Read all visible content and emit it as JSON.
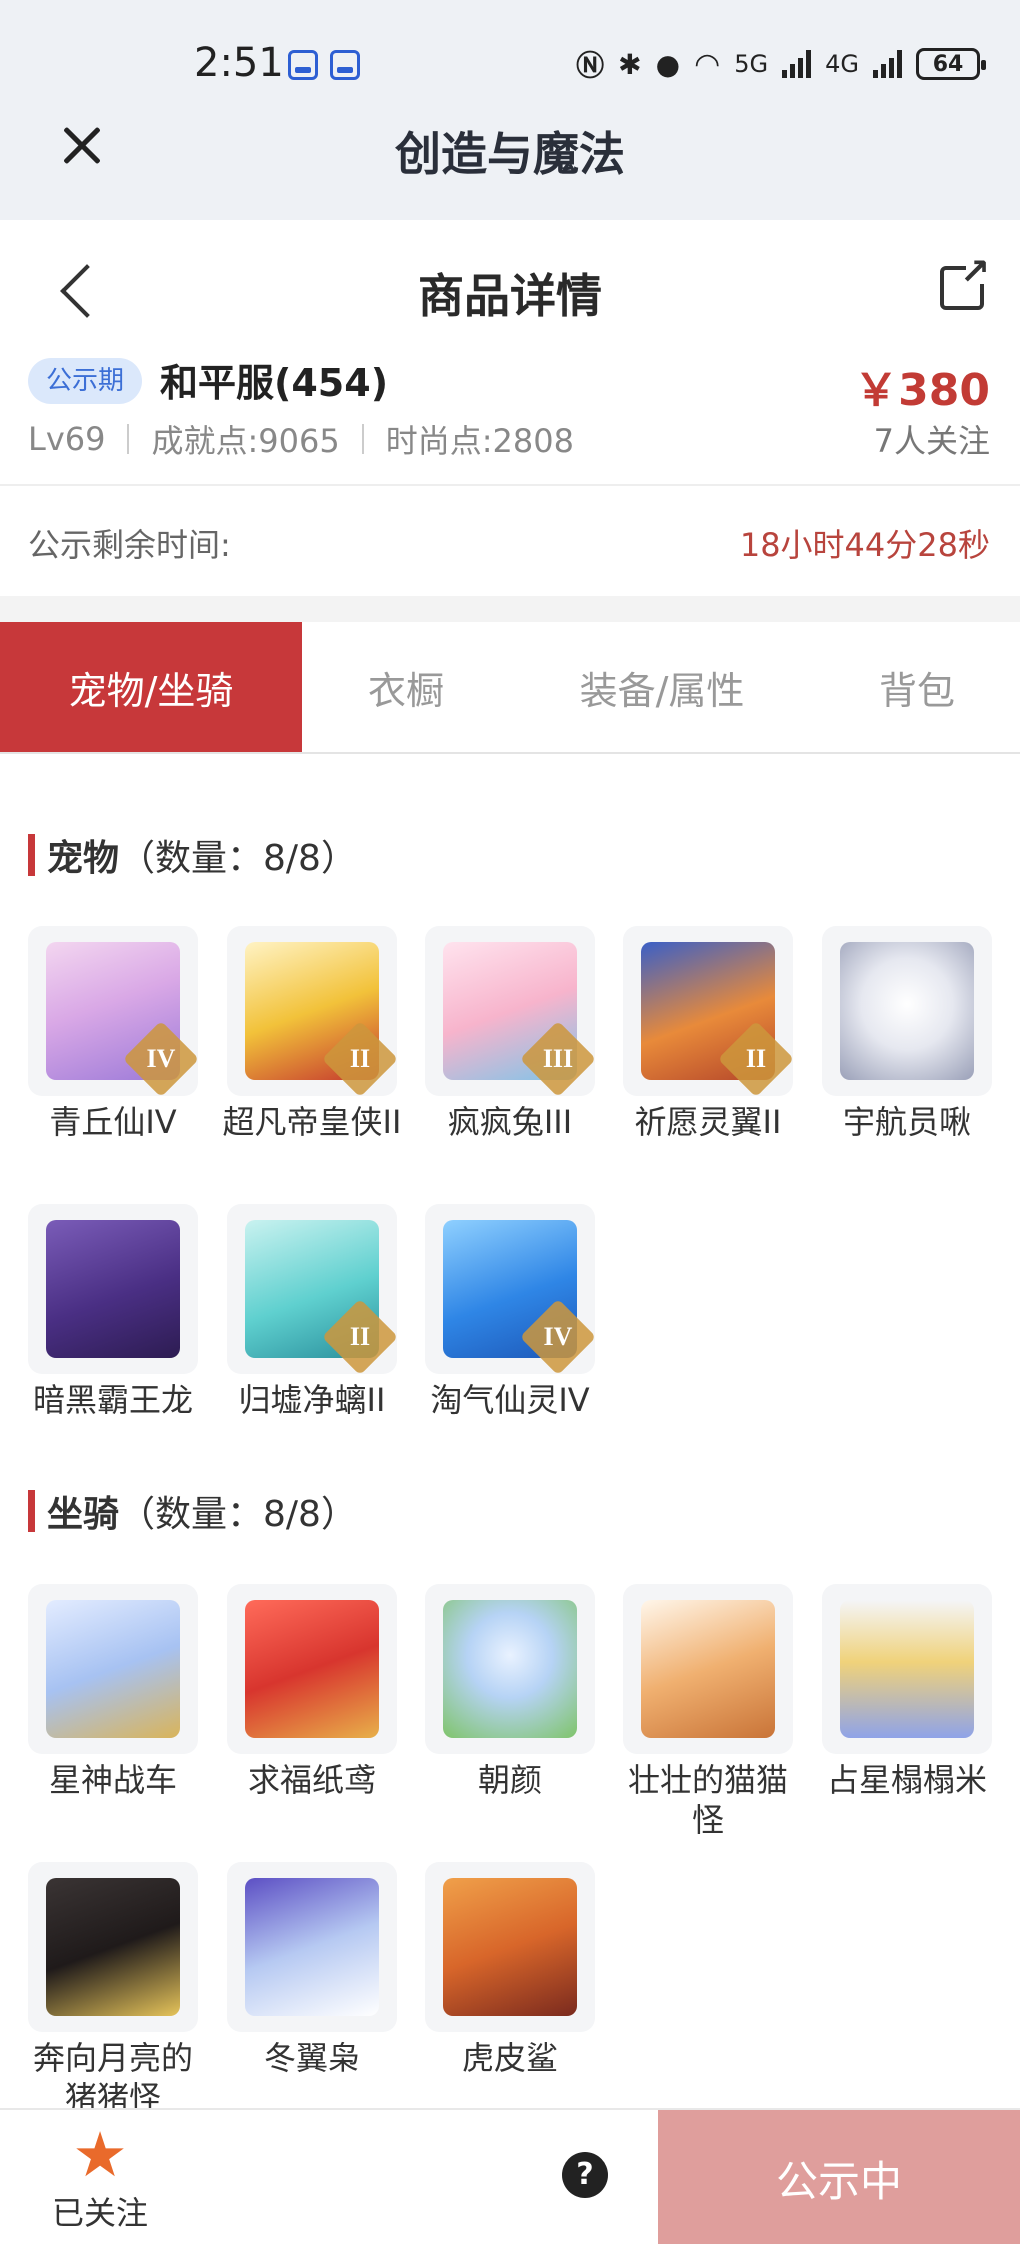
{
  "status_bar": {
    "time": "2:51",
    "battery": "64",
    "network_1": "5G",
    "network_2": "4G"
  },
  "app": {
    "title": "创造与魔法"
  },
  "header": {
    "title": "商品详情"
  },
  "product": {
    "badge": "公示期",
    "server": "和平服(454)",
    "level": "Lv69",
    "achievement": "成就点:9065",
    "fashion": "时尚点:2808",
    "price": "￥380",
    "followers": "7人关注"
  },
  "remaining": {
    "label": "公示剩余时间:",
    "value": "18小时44分28秒"
  },
  "tabs": [
    {
      "label": "宠物/坐骑",
      "active": true
    },
    {
      "label": "衣橱",
      "active": false
    },
    {
      "label": "装备/属性",
      "active": false
    },
    {
      "label": "背包",
      "active": false
    }
  ],
  "pets": {
    "title": "宠物",
    "count": "（数量：8/8）",
    "items": [
      {
        "name": "青丘仙IV",
        "tier": "IV"
      },
      {
        "name": "超凡帝皇侠II",
        "tier": "II"
      },
      {
        "name": "疯疯兔III",
        "tier": "III"
      },
      {
        "name": "祈愿灵翼II",
        "tier": "II"
      },
      {
        "name": "宇航员啾",
        "tier": ""
      },
      {
        "name": "暗黑霸王龙",
        "tier": ""
      },
      {
        "name": "归墟净螭II",
        "tier": "II"
      },
      {
        "name": "淘气仙灵IV",
        "tier": "IV"
      }
    ]
  },
  "mounts": {
    "title": "坐骑",
    "count": "（数量：8/8）",
    "items": [
      {
        "name": "星神战车"
      },
      {
        "name": "求福纸鸢"
      },
      {
        "name": "朝颜"
      },
      {
        "name": "壮壮的猫猫怪"
      },
      {
        "name": "占星榻榻米"
      },
      {
        "name": "奔向月亮的猪猪怪"
      },
      {
        "name": "冬翼枭"
      },
      {
        "name": "虎皮鲨"
      }
    ]
  },
  "bottom": {
    "follow_label": "已关注",
    "help": "?",
    "action": "公示中"
  },
  "colors": {
    "accent": "#c7383a",
    "price": "#c23b35",
    "action_bg": "#df9e9c",
    "star": "#e96a2b"
  }
}
